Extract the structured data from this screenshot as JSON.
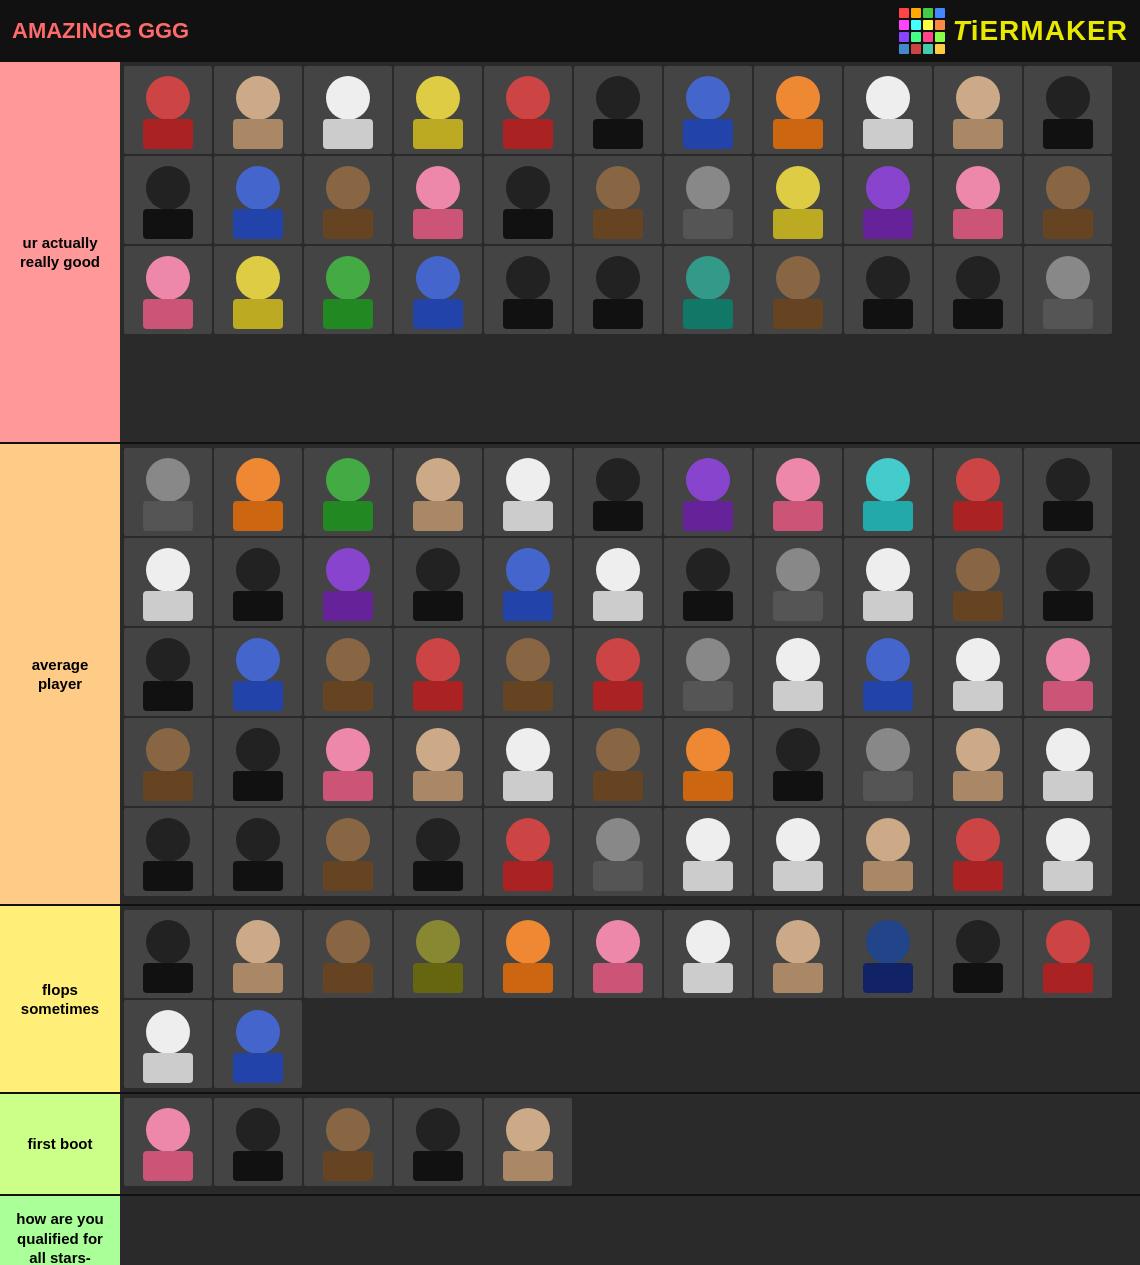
{
  "header": {
    "title": "AMAZINGG GGG",
    "logo_text": "TiERMAKER",
    "logo_highlight": "i"
  },
  "tiers": [
    {
      "id": "s",
      "label": "ur actually really good",
      "color": "#ff9999",
      "avatar_count": 33,
      "avatars": [
        {
          "color": "red"
        },
        {
          "color": "tan"
        },
        {
          "color": "white"
        },
        {
          "color": "yellow"
        },
        {
          "color": "red"
        },
        {
          "color": "black"
        },
        {
          "color": "blue"
        },
        {
          "color": "orange"
        },
        {
          "color": "white"
        },
        {
          "color": "tan"
        },
        {
          "color": "black"
        },
        {
          "color": "black"
        },
        {
          "color": "blue"
        },
        {
          "color": "brown"
        },
        {
          "color": "pink"
        },
        {
          "color": "black"
        },
        {
          "color": "brown"
        },
        {
          "color": "gray"
        },
        {
          "color": "yellow"
        },
        {
          "color": "purple"
        },
        {
          "color": "pink"
        },
        {
          "color": "brown"
        },
        {
          "color": "pink"
        },
        {
          "color": "yellow"
        },
        {
          "color": "green"
        },
        {
          "color": "blue"
        },
        {
          "color": "black"
        },
        {
          "color": "black"
        },
        {
          "color": "teal"
        },
        {
          "color": "brown"
        },
        {
          "color": "black"
        },
        {
          "color": "black"
        },
        {
          "color": "gray"
        }
      ]
    },
    {
      "id": "a",
      "label": "average player",
      "color": "#ffdf7f",
      "avatar_count": 55,
      "avatars": [
        {
          "color": "gray"
        },
        {
          "color": "orange"
        },
        {
          "color": "green"
        },
        {
          "color": "tan"
        },
        {
          "color": "white"
        },
        {
          "color": "black"
        },
        {
          "color": "purple"
        },
        {
          "color": "pink"
        },
        {
          "color": "cyan"
        },
        {
          "color": "red"
        },
        {
          "color": "black"
        },
        {
          "color": "white"
        },
        {
          "color": "black"
        },
        {
          "color": "purple"
        },
        {
          "color": "black"
        },
        {
          "color": "blue"
        },
        {
          "color": "white"
        },
        {
          "color": "black"
        },
        {
          "color": "gray"
        },
        {
          "color": "white"
        },
        {
          "color": "brown"
        },
        {
          "color": "black"
        },
        {
          "color": "black"
        },
        {
          "color": "blue"
        },
        {
          "color": "brown"
        },
        {
          "color": "red"
        },
        {
          "color": "brown"
        },
        {
          "color": "red"
        },
        {
          "color": "gray"
        },
        {
          "color": "white"
        },
        {
          "color": "blue"
        },
        {
          "color": "white"
        },
        {
          "color": "pink"
        },
        {
          "color": "brown"
        },
        {
          "color": "black"
        },
        {
          "color": "pink"
        },
        {
          "color": "tan"
        },
        {
          "color": "white"
        },
        {
          "color": "brown"
        },
        {
          "color": "orange"
        },
        {
          "color": "black"
        },
        {
          "color": "gray"
        },
        {
          "color": "tan"
        },
        {
          "color": "white"
        },
        {
          "color": "black"
        },
        {
          "color": "black"
        },
        {
          "color": "brown"
        },
        {
          "color": "black"
        },
        {
          "color": "red"
        },
        {
          "color": "gray"
        },
        {
          "color": "white"
        },
        {
          "color": "white"
        },
        {
          "color": "tan"
        },
        {
          "color": "red"
        },
        {
          "color": "white"
        }
      ]
    },
    {
      "id": "b",
      "label": "flops sometimes",
      "color": "#ffff88",
      "avatar_count": 13,
      "avatars": [
        {
          "color": "black"
        },
        {
          "color": "tan"
        },
        {
          "color": "brown"
        },
        {
          "color": "olive"
        },
        {
          "color": "orange"
        },
        {
          "color": "pink"
        },
        {
          "color": "white"
        },
        {
          "color": "tan"
        },
        {
          "color": "navy"
        },
        {
          "color": "black"
        },
        {
          "color": "red"
        },
        {
          "color": "white"
        },
        {
          "color": "blue"
        }
      ]
    },
    {
      "id": "c",
      "label": "first boot",
      "color": "#bbff99",
      "avatar_count": 5,
      "avatars": [
        {
          "color": "pink"
        },
        {
          "color": "black"
        },
        {
          "color": "brown"
        },
        {
          "color": "black"
        },
        {
          "color": "tan"
        }
      ]
    },
    {
      "id": "d",
      "label": "how are you qualified for all stars-",
      "color": "#aaff99",
      "avatar_count": 0,
      "avatars": []
    }
  ],
  "logo_colors": [
    "#ff4444",
    "#ffaa00",
    "#44cc44",
    "#4488ff",
    "#ff44ff",
    "#44ffff",
    "#ffff44",
    "#ff8844",
    "#8844ff",
    "#44ff88",
    "#ff4488",
    "#88ff44",
    "#4488cc",
    "#cc4444",
    "#44ccaa",
    "#ffcc44"
  ]
}
